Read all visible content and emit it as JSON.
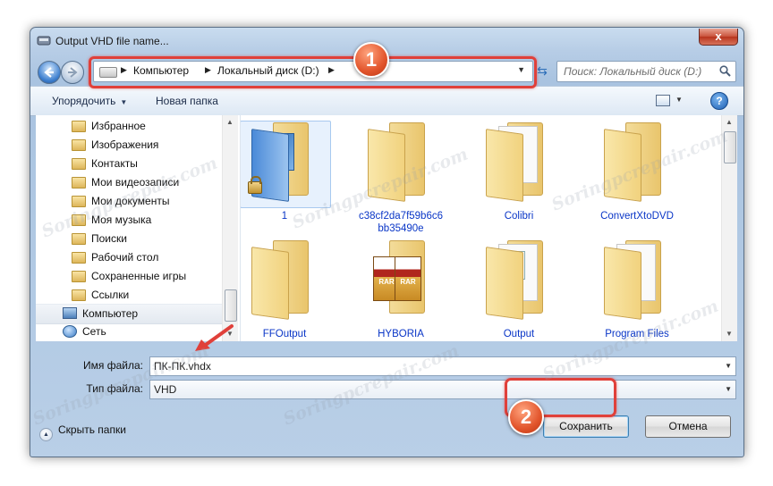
{
  "window": {
    "title": "Output VHD file name...",
    "close_glyph": "x"
  },
  "address": {
    "crumbs": [
      "Компьютер",
      "Локальный диск (D:)"
    ],
    "search_placeholder": "Поиск: Локальный диск (D:)"
  },
  "toolbar": {
    "organize_label": "Упорядочить",
    "new_folder_label": "Новая папка",
    "help_glyph": "?"
  },
  "nav": {
    "items": [
      {
        "label": "Избранное"
      },
      {
        "label": "Изображения"
      },
      {
        "label": "Контакты"
      },
      {
        "label": "Мои видеозаписи"
      },
      {
        "label": "Мои документы"
      },
      {
        "label": "Моя музыка"
      },
      {
        "label": "Поиски"
      },
      {
        "label": "Рабочий стол"
      },
      {
        "label": "Сохраненные игры"
      },
      {
        "label": "Ссылки"
      }
    ],
    "computer_label": "Компьютер",
    "network_label": "Сеть"
  },
  "files": [
    {
      "name": "1",
      "icon": "locked-folder-icon"
    },
    {
      "name": "c38cf2da7f59b6c6bb35490e",
      "icon": "folder-icon"
    },
    {
      "name": "Colibri",
      "icon": "folder-icon"
    },
    {
      "name": "ConvertXtoDVD",
      "icon": "folder-icon"
    },
    {
      "name": "FFOutput",
      "icon": "folder-icon"
    },
    {
      "name": "HYBORIA",
      "icon": "rar-folder-icon"
    },
    {
      "name": "Output",
      "icon": "folder-icon"
    },
    {
      "name": "Program Files",
      "icon": "folder-icon"
    }
  ],
  "rar_label": "RAR",
  "form": {
    "filename_label": "Имя файла:",
    "filename_value": "ПК-ПК.vhdx",
    "filetype_label": "Тип файла:",
    "filetype_value": "VHD"
  },
  "footer": {
    "hide_folders_label": "Скрыть папки",
    "save_label": "Сохранить",
    "cancel_label": "Отмена"
  },
  "annotations": {
    "step1": "1",
    "step2": "2",
    "accent_color": "#e0403a"
  },
  "watermark": "Soringpcrepair.com"
}
